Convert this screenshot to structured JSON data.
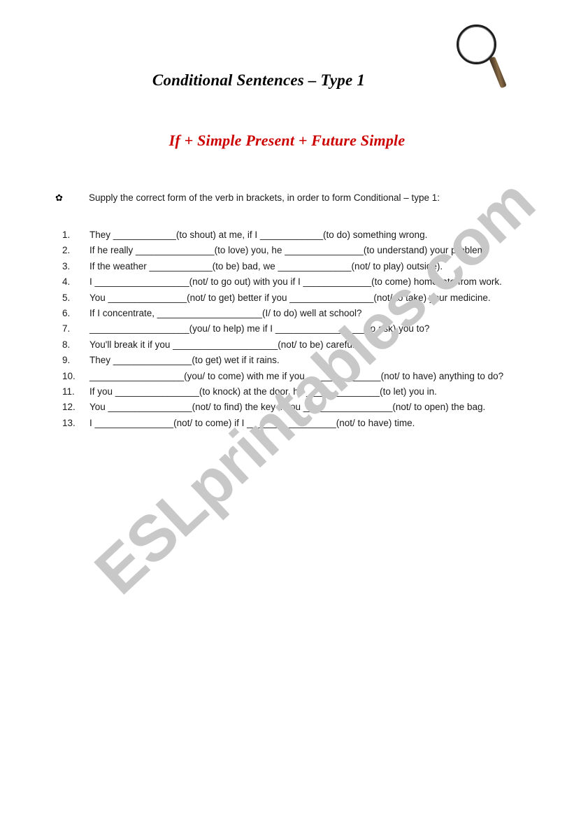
{
  "document": {
    "title": "Conditional Sentences – Type 1",
    "subtitle": "If + Simple Present + Future Simple",
    "watermark": "ESLprintables.com"
  },
  "instruction": {
    "bullet": "✿",
    "text": "Supply the correct form of the verb in brackets, in order to form Conditional – type 1:"
  },
  "exercises": [
    {
      "number": "1.",
      "text": "They ____________(to shout) at me, if I ____________(to do) something wrong."
    },
    {
      "number": "2.",
      "text": "If he really _______________(to love) you, he _______________(to understand) your problem."
    },
    {
      "number": "3.",
      "text": "If the weather ____________(to be) bad, we ______________(not/ to play) outside)."
    },
    {
      "number": "4.",
      "text": "I __________________(not/ to go out) with you if I _____________(to come) home late from work."
    },
    {
      "number": "5.",
      "text": "You _______________(not/ to get) better if you ________________(not/ to take) your medicine."
    },
    {
      "number": "6.",
      "text": "If I concentrate, ____________________(I/ to do) well at school?"
    },
    {
      "number": "7.",
      "text": "___________________(you/ to help) me if I _________________(to ask) you to?"
    },
    {
      "number": "8.",
      "text": "You'll break it if you ____________________(not/ to be) careful."
    },
    {
      "number": "9.",
      "text": "They _______________(to get) wet if it rains."
    },
    {
      "number": "10.",
      "text": "__________________(you/ to come) with me if you ______________(not/ to have) anything to do?",
      "justify": true
    },
    {
      "number": "11.",
      "text": "If you ________________(to knock) at the door, he ______________(to let) you in."
    },
    {
      "number": "12.",
      "text": "You ________________(not/ to find) the key if you _________________(not/ to open) the bag."
    },
    {
      "number": "13.",
      "text": "I _______________(not/ to come) if I _________________(not/ to have) time."
    }
  ],
  "icons": {
    "magnifier": "magnifying-glass-icon"
  },
  "colors": {
    "subtitle_red": "#CC0000",
    "watermark_gray": "#C8C8C8",
    "handle_brown": "#6B5338",
    "text_black": "#1A1A1A"
  }
}
